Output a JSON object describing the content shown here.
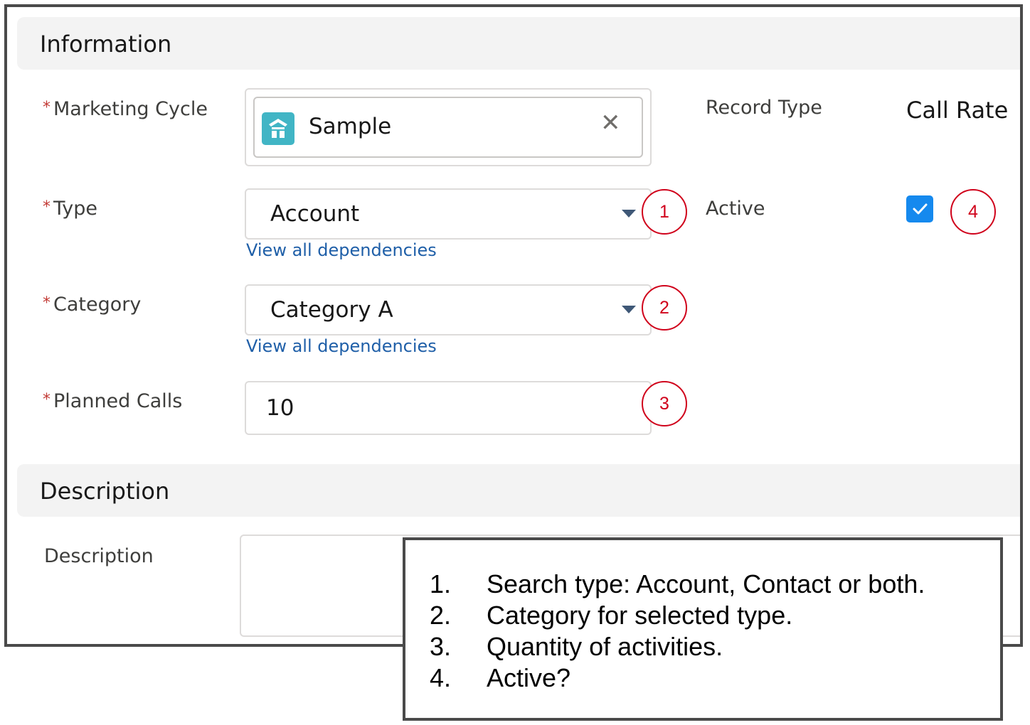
{
  "sections": {
    "information": "Information",
    "description": "Description"
  },
  "required_mark": "*",
  "marketing_cycle": {
    "label": "Marketing Cycle",
    "value": "Sample",
    "icon": "campaign-icon",
    "clear_icon": "✕"
  },
  "type": {
    "label": "Type",
    "value": "Account",
    "link": "View all dependencies"
  },
  "category": {
    "label": "Category",
    "value": "Category A",
    "link": "View all dependencies"
  },
  "planned_calls": {
    "label": "Planned Calls",
    "value": "10"
  },
  "record_type": {
    "label": "Record Type",
    "value": "Call Rate"
  },
  "active": {
    "label": "Active",
    "checked": true
  },
  "description": {
    "label": "Description",
    "value": ""
  },
  "callouts": [
    "1",
    "2",
    "3",
    "4"
  ],
  "notes": [
    {
      "num": "1.",
      "text": "Search type: Account, Contact or both."
    },
    {
      "num": "2.",
      "text": "Category for selected type."
    },
    {
      "num": "3.",
      "text": "Quantity of activities."
    },
    {
      "num": "4.",
      "text": "Active?"
    }
  ],
  "colors": {
    "required": "#c23934",
    "link": "#1f5fa8",
    "checkbox": "#1589ee",
    "callout": "#d0021b",
    "lookup_icon": "#41b5c5"
  }
}
